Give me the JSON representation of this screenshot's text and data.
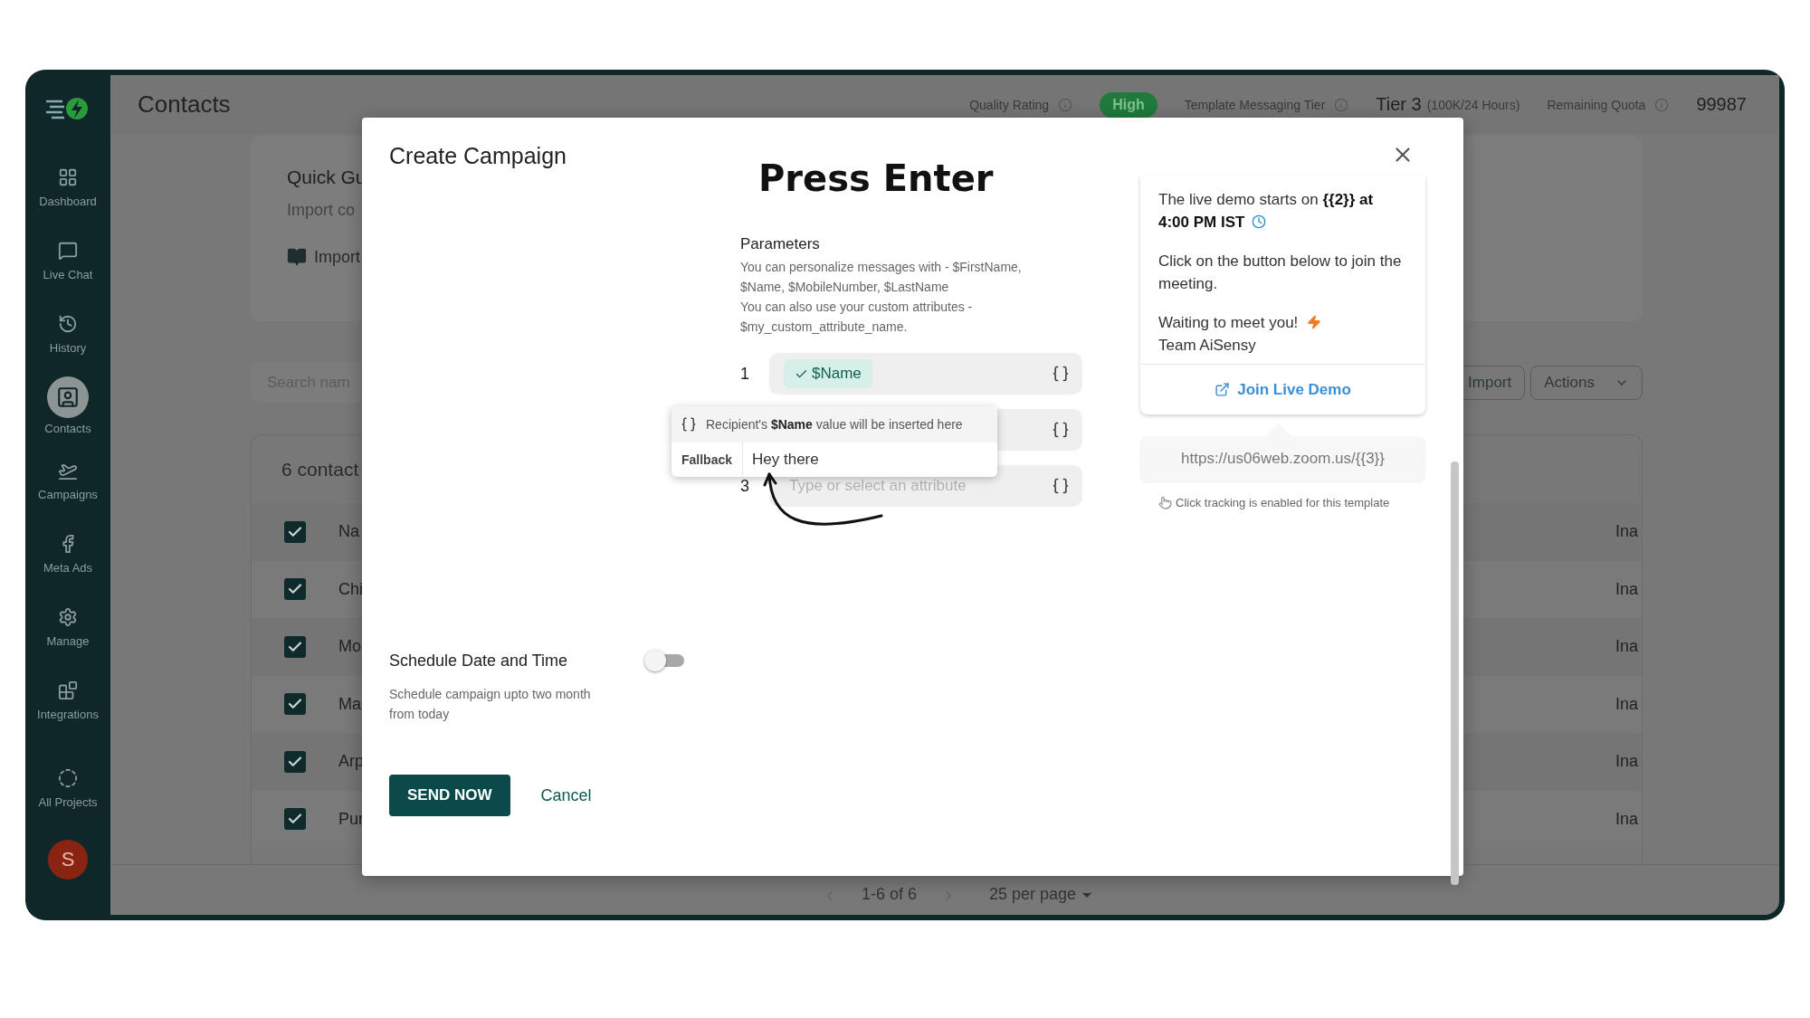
{
  "sidebar": {
    "items": [
      {
        "label": "Dashboard",
        "selected": false
      },
      {
        "label": "Live Chat",
        "selected": false
      },
      {
        "label": "History",
        "selected": false
      },
      {
        "label": "Contacts",
        "selected": true
      },
      {
        "label": "Campaigns",
        "selected": false
      },
      {
        "label": "Meta Ads",
        "selected": false
      },
      {
        "label": "Manage",
        "selected": false
      },
      {
        "label": "Integrations",
        "selected": false
      }
    ],
    "footer": "All Projects",
    "avatar": "S"
  },
  "header": {
    "title": "Contacts",
    "quality_label": "Quality Rating",
    "quality_value": "High",
    "tier_label": "Template Messaging Tier",
    "tier": "Tier 3",
    "tier_limit": "(100K/24 Hours)",
    "quota_label": "Remaining Quota",
    "quota": "99987"
  },
  "quick_guide": {
    "title": "Quick Gu",
    "text": "Import co",
    "link": "Import"
  },
  "search": {
    "placeholder": "Search nam"
  },
  "actions": [
    {
      "label": "Import",
      "kind": "plain"
    },
    {
      "label": "Actions",
      "kind": "menu"
    }
  ],
  "contacts": {
    "count": "6 contact",
    "rows": [
      {
        "name": "Na",
        "checked": true,
        "column_2": "Ina"
      },
      {
        "name": "Chi",
        "checked": true,
        "column_2": "Ina"
      },
      {
        "name": "Mo",
        "checked": true,
        "column_2": "Ina"
      },
      {
        "name": "Ma",
        "checked": true,
        "column_2": "Ina"
      },
      {
        "name": "Arp",
        "checked": true,
        "column_2": "Ina"
      },
      {
        "name": "Pur",
        "checked": true,
        "column_2": "Ina"
      }
    ]
  },
  "pagination": {
    "range": "1-6 of 6",
    "per_page": "25 per page"
  },
  "modal": {
    "title": "Create Campaign",
    "annotation": "Press Enter",
    "parameters": {
      "title": "Parameters",
      "help": [
        "You can personalize messages with - $FirstName, $Name, $MobileNumber, $LastName",
        "You can also use your custom attributes - $my_custom_attribute_name."
      ],
      "rows": [
        {
          "kind": "chip",
          "number": "1",
          "value": "$Name"
        },
        {
          "kind": "covered"
        },
        {
          "kind": "empty",
          "number": "3",
          "placeholder": "Type or select an attribute"
        }
      ]
    },
    "popover": {
      "text": "Recipient's **$Name** value will be inserted here",
      "fallback_label": "Fallback",
      "fallback_value": "Hey there"
    },
    "preview": {
      "paragraphs": [
        {
          "lines": [
            "The live demo starts on **{{2}} at 4:00 PM IST**"
          ]
        },
        {
          "lines": [
            "Click on the button below to join the meeting."
          ]
        },
        {
          "lines": [
            "Waiting to meet you!",
            "Team AiSensy"
          ]
        }
      ],
      "button": "Join Live Demo",
      "url": "https://us06web.zoom.us/{{3}}",
      "tracking": "Click tracking is enabled for this template"
    },
    "schedule": {
      "label": "Schedule Date and Time",
      "on": false,
      "help": "Schedule campaign upto two month from today"
    },
    "buttons": {
      "primary": "SEND NOW",
      "secondary": "Cancel"
    }
  }
}
